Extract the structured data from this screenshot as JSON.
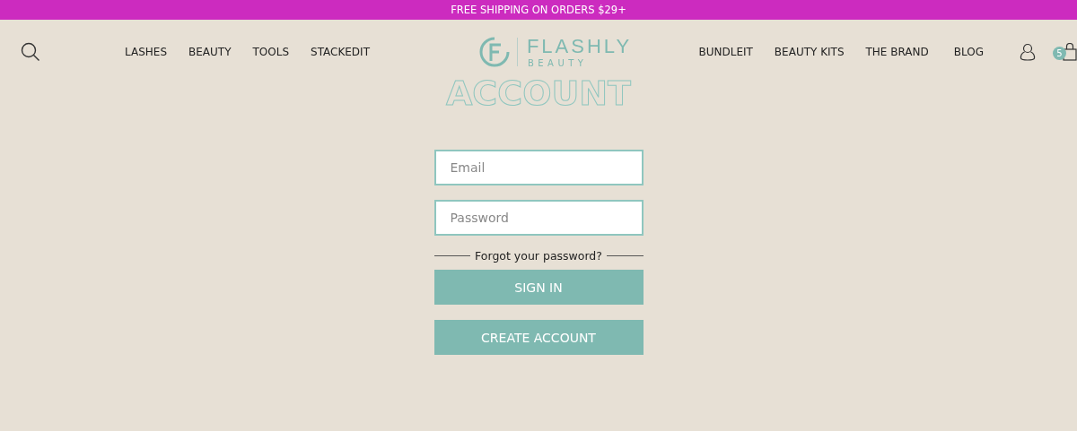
{
  "announcement": "FREE SHIPPING ON ORDERS $29+",
  "nav_left": [
    "LASHES",
    "BEAUTY",
    "TOOLS",
    "STACKEDIT"
  ],
  "logo": {
    "name": "FLASHLY",
    "tagline": "BEAUTY"
  },
  "nav_right": [
    "BUNDLEIT",
    "BEAUTY KITS",
    "THE BRAND",
    "BLOG"
  ],
  "cart": {
    "count": "5"
  },
  "page_title": "ACCOUNT",
  "form": {
    "email": {
      "placeholder": "Email"
    },
    "password": {
      "placeholder": "Password"
    },
    "forgot_link": "Forgot your password?",
    "buttons": [
      "SIGN IN",
      "CREATE ACCOUNT"
    ]
  }
}
